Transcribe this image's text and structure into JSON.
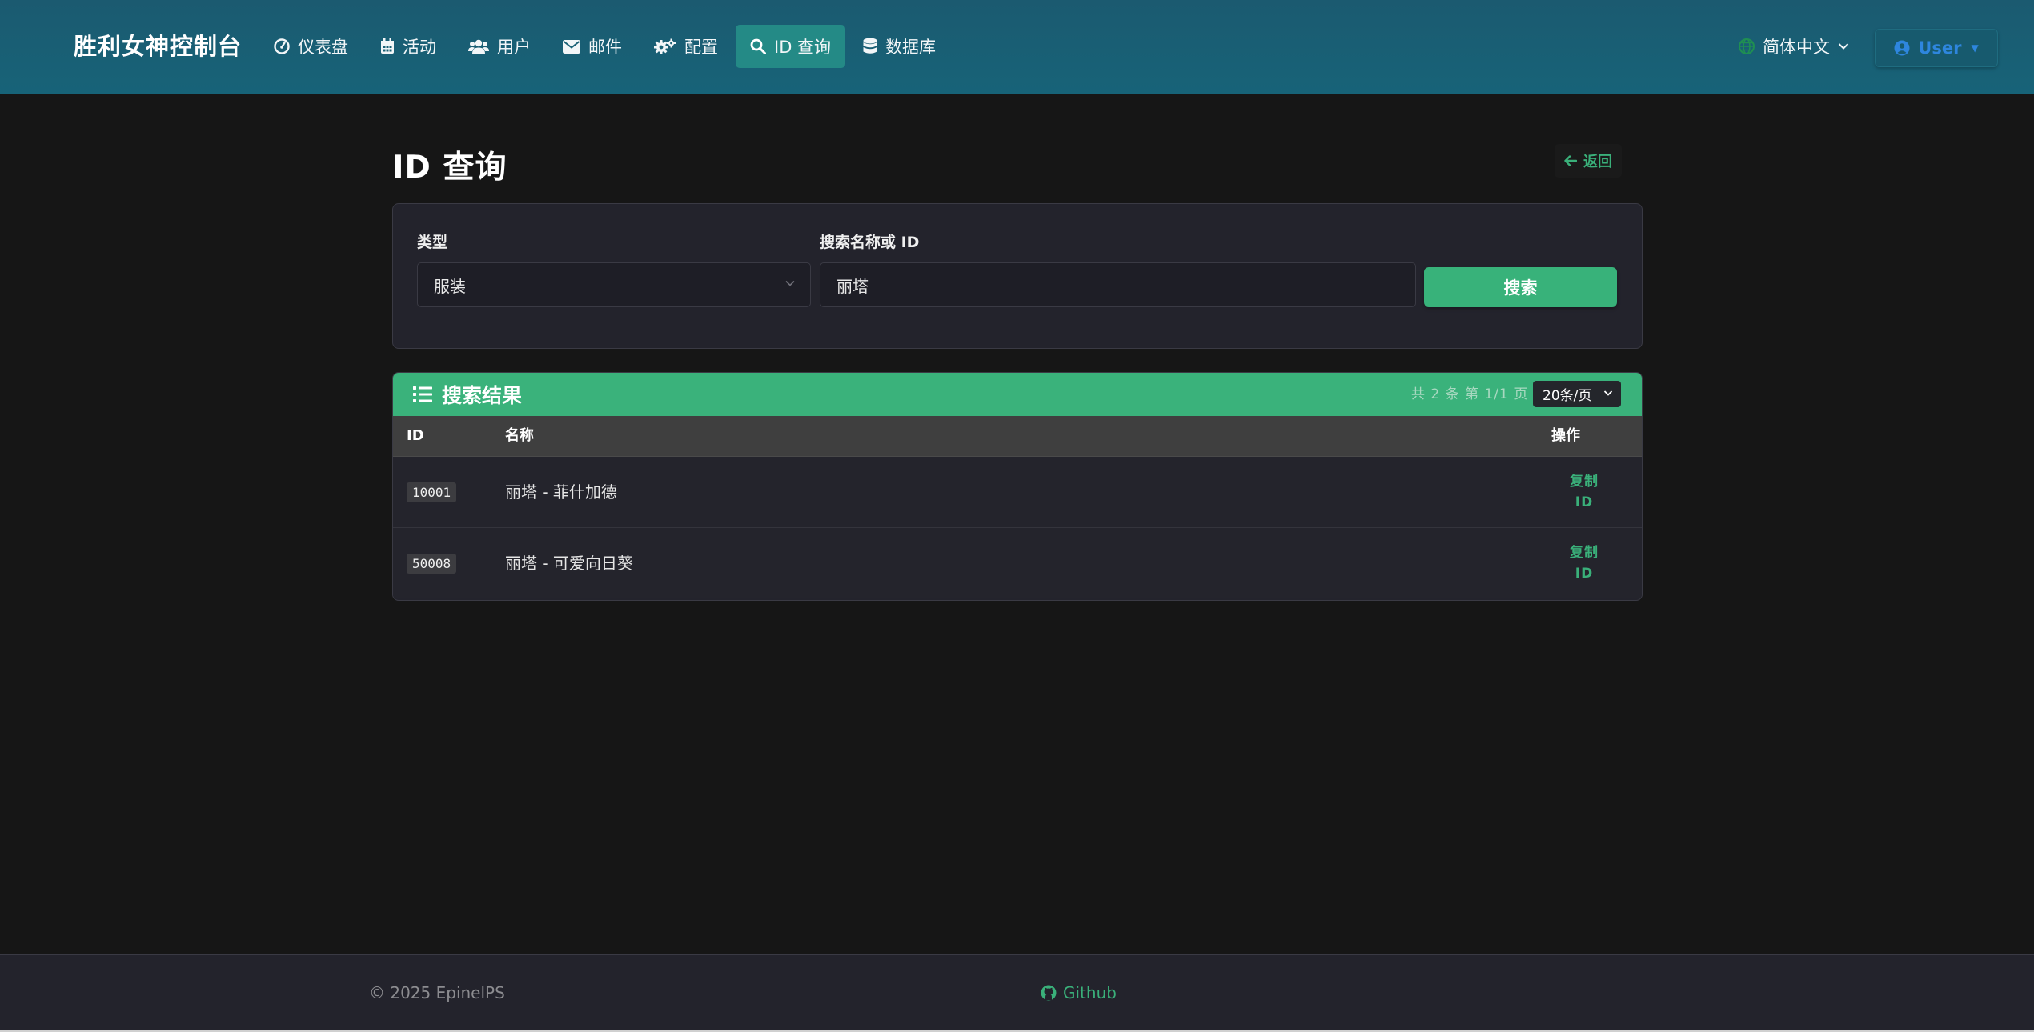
{
  "colors": {
    "navbar": "#176378",
    "accent": "#38b27a",
    "link_blue": "#2e86de",
    "background": "#161616",
    "card": "#23232c"
  },
  "navbar": {
    "brand": "胜利女神控制台",
    "items": [
      {
        "label": "仪表盘",
        "icon": "dashboard-icon",
        "active": false
      },
      {
        "label": "活动",
        "icon": "calendar-icon",
        "active": false
      },
      {
        "label": "用户",
        "icon": "users-icon",
        "active": false
      },
      {
        "label": "邮件",
        "icon": "envelope-icon",
        "active": false
      },
      {
        "label": "配置",
        "icon": "gears-icon",
        "active": false
      },
      {
        "label": "ID 查询",
        "icon": "search-icon",
        "active": true
      },
      {
        "label": "数据库",
        "icon": "database-icon",
        "active": false
      }
    ],
    "language": "简体中文",
    "user": "User"
  },
  "page": {
    "title": "ID 查询",
    "back_label": "返回"
  },
  "search": {
    "type_label": "类型",
    "type_value": "服装",
    "query_label": "搜索名称或 ID",
    "query_value": "丽塔",
    "button_label": "搜索"
  },
  "results": {
    "title": "搜索结果",
    "page_info": "共 2 条 第 1/1 页",
    "page_size": "20条/页",
    "columns": {
      "id": "ID",
      "name": "名称",
      "action": "操作"
    },
    "rows": [
      {
        "id": "10001",
        "name": "丽塔 - 菲什加德",
        "action_line1": "复制",
        "action_line2": "ID"
      },
      {
        "id": "50008",
        "name": "丽塔 - 可爱向日葵",
        "action_line1": "复制",
        "action_line2": "ID"
      }
    ]
  },
  "footer": {
    "copyright": "© 2025 EpinelPS",
    "github": "Github"
  }
}
